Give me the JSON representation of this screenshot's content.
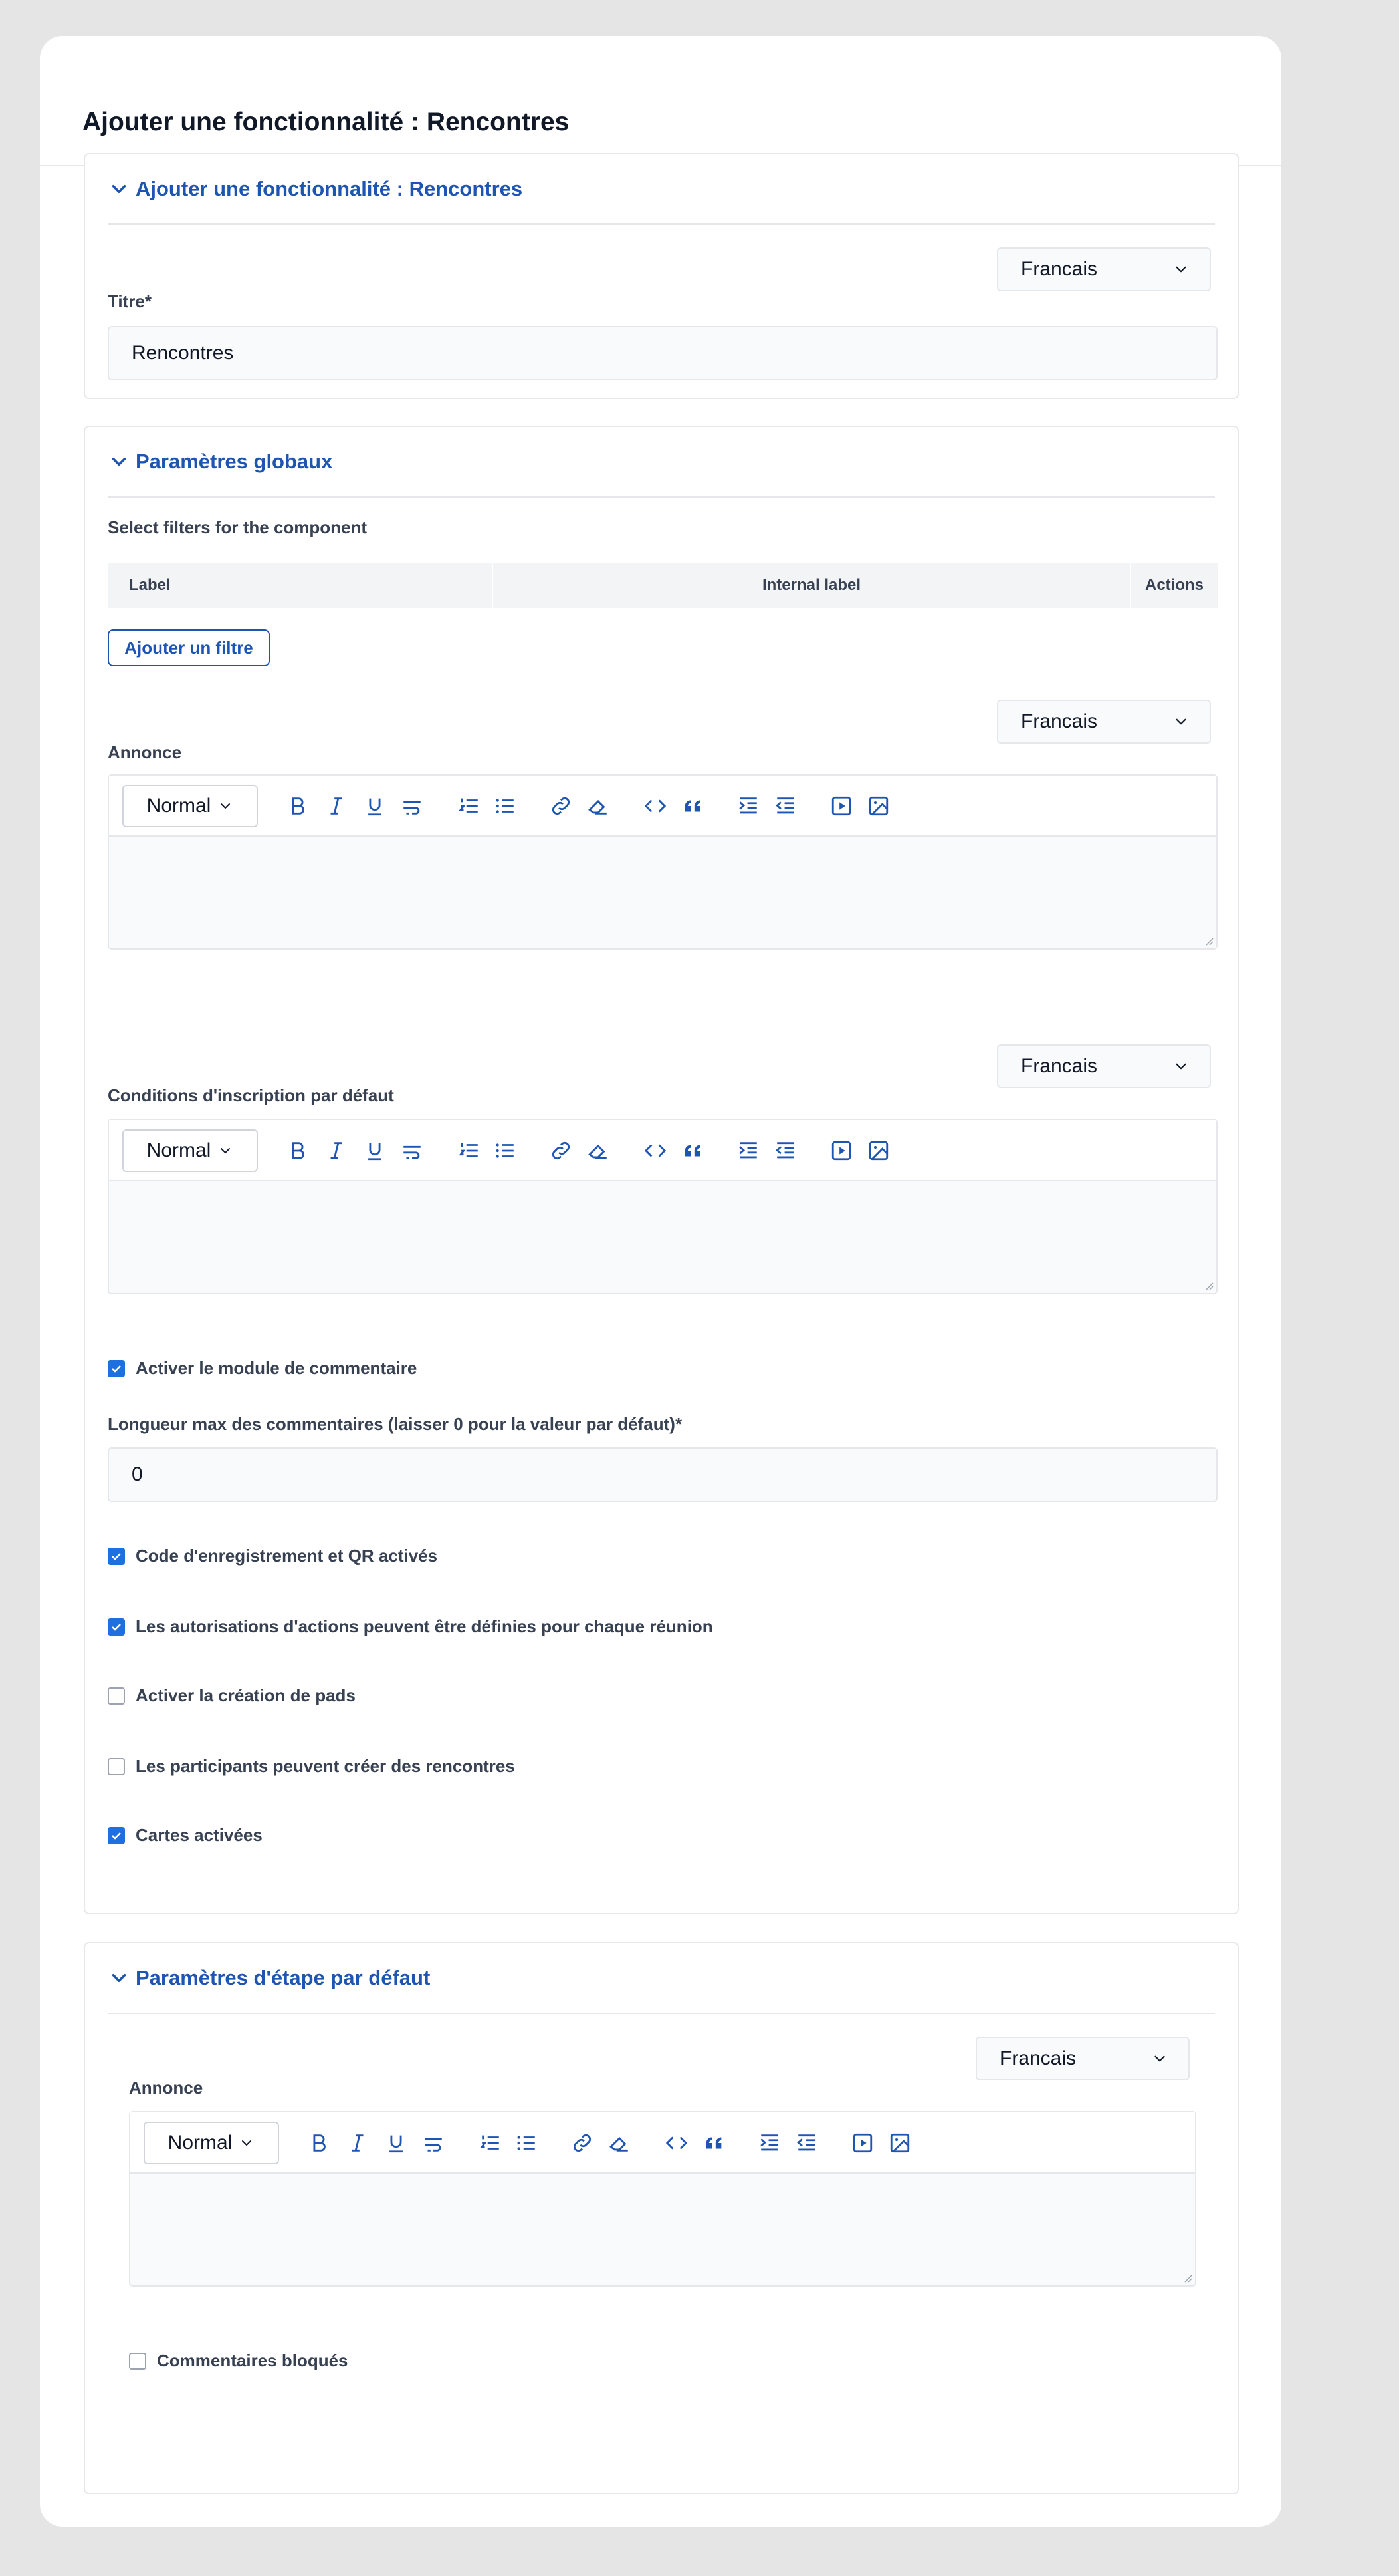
{
  "page": {
    "title": "Ajouter une fonctionnalité : Rencontres"
  },
  "section_main": {
    "header": "Ajouter une fonctionnalité : Rencontres",
    "language": "Francais",
    "title_label": "Titre*",
    "title_value": "Rencontres"
  },
  "section_global": {
    "header": "Paramètres globaux",
    "filters_label": "Select filters for the component",
    "table_columns": [
      "Label",
      "Internal label",
      "Actions"
    ],
    "add_filter_button": "Ajouter un filtre",
    "announcement": {
      "language": "Francais",
      "label": "Annonce",
      "format": "Normal"
    },
    "registration_terms": {
      "language": "Francais",
      "label": "Conditions d'inscription par défaut",
      "format": "Normal"
    },
    "checkboxes": [
      {
        "label": "Activer le module de commentaire",
        "checked": true
      },
      {
        "label": "Code d'enregistrement et QR activés",
        "checked": true
      },
      {
        "label": "Les autorisations d'actions peuvent être définies pour chaque réunion",
        "checked": true
      },
      {
        "label": "Activer la création de pads",
        "checked": false
      },
      {
        "label": "Les participants peuvent créer des rencontres",
        "checked": false
      },
      {
        "label": "Cartes activées",
        "checked": true
      }
    ],
    "comment_length_label": "Longueur max des commentaires (laisser 0 pour la valeur par défaut)*",
    "comment_length_value": "0"
  },
  "section_step": {
    "header": "Paramètres d'étape par défaut",
    "announcement": {
      "language": "Francais",
      "label": "Annonce",
      "format": "Normal"
    },
    "comments_blocked": {
      "label": "Commentaires bloqués",
      "checked": false
    }
  },
  "colors": {
    "accent": "#1e55b3",
    "checkbox": "#1e6fe0",
    "background": "#e5e5e5",
    "card": "#ffffff"
  },
  "toolbar_icons": [
    "bold-icon",
    "italic-icon",
    "underline-icon",
    "strikethrough-icon",
    "ordered-list-icon",
    "bullet-list-icon",
    "link-icon",
    "eraser-icon",
    "code-icon",
    "quote-icon",
    "indent-icon",
    "outdent-icon",
    "video-icon",
    "image-icon"
  ]
}
